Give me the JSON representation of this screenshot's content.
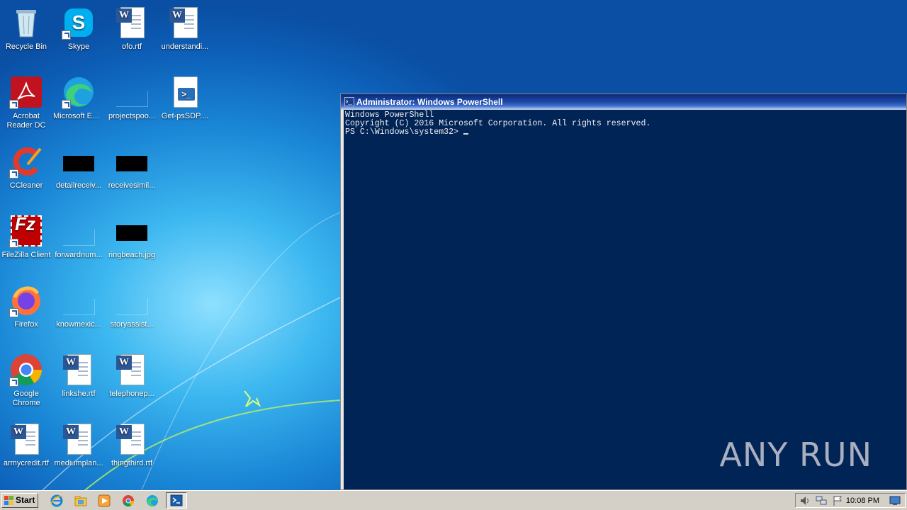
{
  "desktop": {
    "icons": [
      {
        "label": "Recycle Bin"
      },
      {
        "label": "Skype"
      },
      {
        "label": "ofo.rtf"
      },
      {
        "label": "understandi..."
      },
      {
        "label": "Acrobat Reader DC"
      },
      {
        "label": "Microsoft Edge"
      },
      {
        "label": "projectspoo..."
      },
      {
        "label": "Get-psSDP...."
      },
      {
        "label": "CCleaner"
      },
      {
        "label": "detailreceiv..."
      },
      {
        "label": "receivesimil..."
      },
      {
        "label": "FileZilla Client"
      },
      {
        "label": "forwardnum..."
      },
      {
        "label": "ringbeach.jpg"
      },
      {
        "label": "Firefox"
      },
      {
        "label": "knowmexic..."
      },
      {
        "label": "storyassist..."
      },
      {
        "label": "Google Chrome"
      },
      {
        "label": "linkshe.rtf"
      },
      {
        "label": "telephonep..."
      },
      {
        "label": "armycredit.rtf"
      },
      {
        "label": "mediumplan..."
      },
      {
        "label": "thingthird.rtf"
      }
    ]
  },
  "powershell": {
    "title": "Administrator: Windows PowerShell",
    "lines": [
      "Windows PowerShell",
      "Copyright (C) 2016 Microsoft Corporation. All rights reserved.",
      "",
      "PS C:\\Windows\\system32> "
    ]
  },
  "watermark": "ANY RUN",
  "taskbar": {
    "start_label": "Start",
    "clock": "10:08 PM",
    "pinned": [
      "internet-explorer-icon",
      "explorer-icon",
      "media-player-icon",
      "chrome-icon",
      "edge-icon",
      "powershell-icon"
    ]
  },
  "colors": {
    "console_bg": "#012456",
    "console_fg": "#eeedf0",
    "title_bar": "#0a2a7a",
    "taskbar": "#d4d0c8"
  }
}
